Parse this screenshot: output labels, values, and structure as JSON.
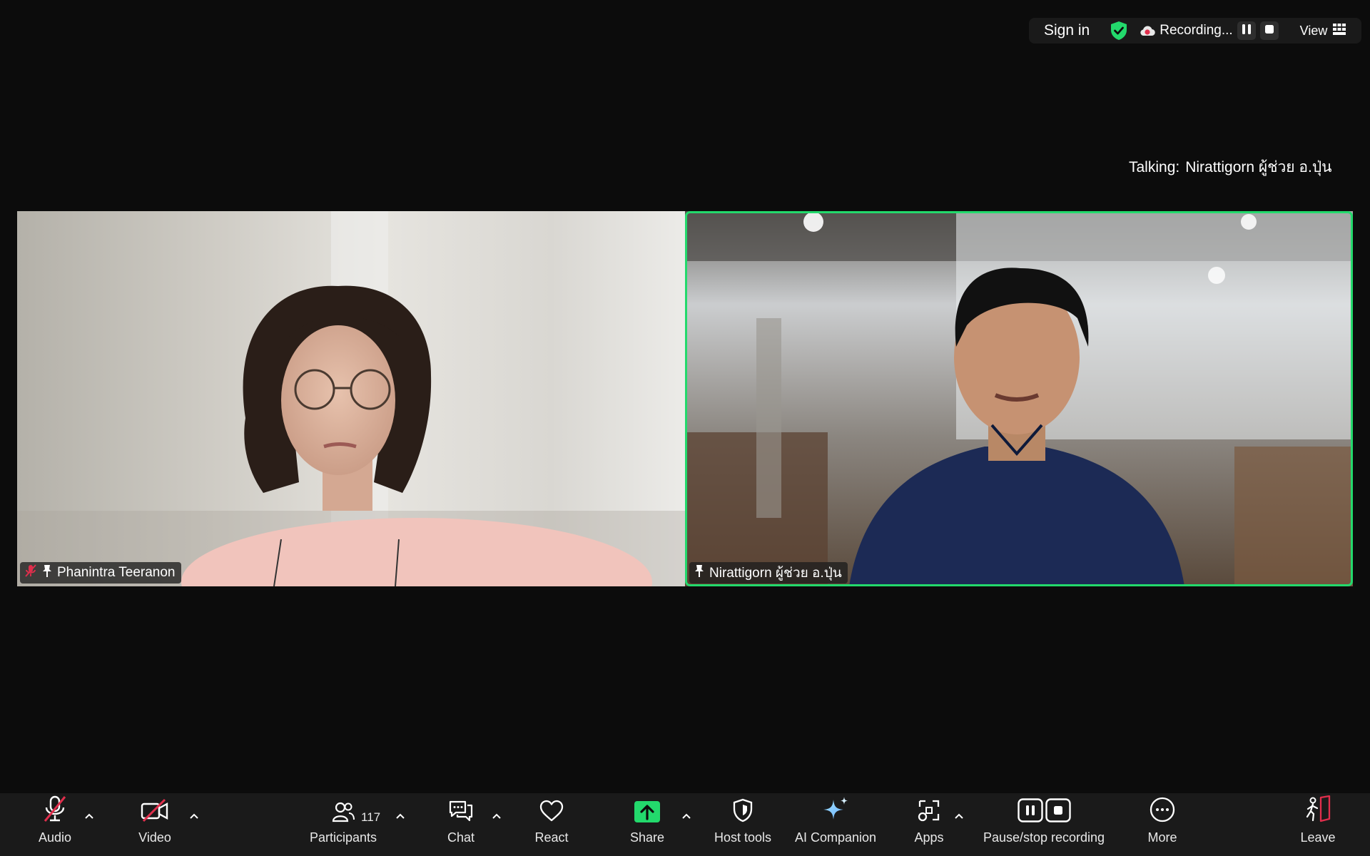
{
  "top_bar": {
    "sign_in": "Sign in",
    "recording_label": "Recording...",
    "view_label": "View",
    "icons": [
      "shield-check-icon",
      "cloud-record-icon",
      "pause-icon",
      "stop-icon",
      "grid-icon"
    ],
    "colors": {
      "shield": "#23d96c",
      "record": "#e02e4c"
    }
  },
  "talking": {
    "label": "Talking:",
    "name": "Nirattigorn ผู้ช่วย อ.ปุ่น"
  },
  "participants": [
    {
      "name": "Phanintra Teeranon",
      "muted": true,
      "pinned": true
    },
    {
      "name": "Nirattigorn ผู้ช่วย อ.ปุ่น",
      "muted": false,
      "pinned": true,
      "active_speaker": true
    }
  ],
  "toolbar": {
    "audio": "Audio",
    "video": "Video",
    "participants": "Participants",
    "participants_count": "117",
    "chat": "Chat",
    "react": "React",
    "share": "Share",
    "host_tools": "Host tools",
    "ai_companion": "AI Companion",
    "apps": "Apps",
    "pause_stop": "Pause/stop recording",
    "more": "More",
    "leave": "Leave"
  },
  "colors": {
    "background": "#0c0c0c",
    "toolbar": "#1a1a1a",
    "active_speaker_border": "#23d96c",
    "share_green": "#23d96c",
    "muted_red": "#e02e4c"
  }
}
